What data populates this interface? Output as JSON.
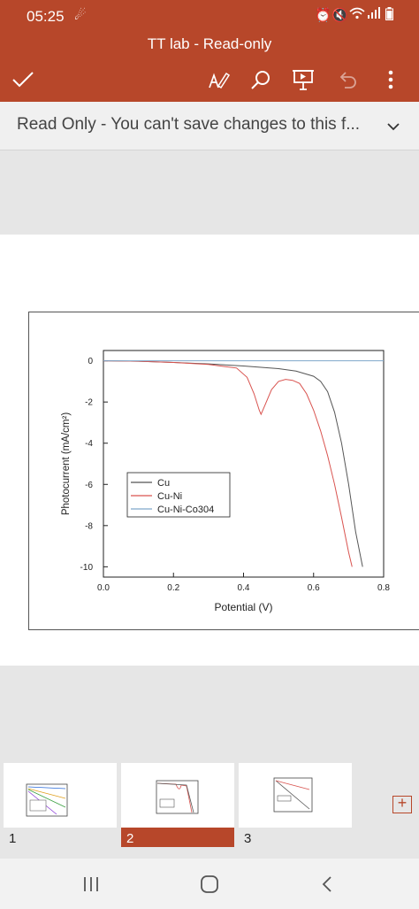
{
  "status_bar": {
    "time": "05:25"
  },
  "app_bar": {
    "title": "TT lab - Read-only"
  },
  "banner": {
    "text": "Read Only - You can't save changes to this f..."
  },
  "slide": {
    "chart_data": {
      "type": "line",
      "xlabel": "Potential (V)",
      "ylabel": "Photocurrent (mA/cm²)",
      "xlim": [
        0.0,
        0.8
      ],
      "ylim": [
        -10.5,
        0.5
      ],
      "x_ticks": [
        "0.0",
        "0.2",
        "0.4",
        "0.6",
        "0.8"
      ],
      "y_ticks": [
        "0",
        "-2",
        "-4",
        "-6",
        "-8",
        "-10"
      ],
      "legend_position": "lower-left",
      "series": [
        {
          "name": "Cu",
          "color": "#555555",
          "x": [
            0.0,
            0.1,
            0.2,
            0.3,
            0.4,
            0.5,
            0.55,
            0.6,
            0.62,
            0.64,
            0.66,
            0.68,
            0.7,
            0.72,
            0.74
          ],
          "y": [
            0.0,
            -0.02,
            -0.08,
            -0.15,
            -0.25,
            -0.38,
            -0.5,
            -0.75,
            -1.0,
            -1.5,
            -2.5,
            -4.0,
            -6.0,
            -8.3,
            -10.0
          ]
        },
        {
          "name": "Cu-Ni",
          "color": "#d9534f",
          "x": [
            0.0,
            0.1,
            0.2,
            0.3,
            0.38,
            0.41,
            0.43,
            0.445,
            0.45,
            0.46,
            0.48,
            0.5,
            0.52,
            0.54,
            0.56,
            0.58,
            0.6,
            0.62,
            0.64,
            0.66,
            0.68,
            0.7,
            0.71
          ],
          "y": [
            0.0,
            -0.02,
            -0.08,
            -0.18,
            -0.35,
            -0.8,
            -1.6,
            -2.4,
            -2.6,
            -2.2,
            -1.4,
            -1.0,
            -0.9,
            -0.95,
            -1.1,
            -1.6,
            -2.4,
            -3.4,
            -4.6,
            -6.0,
            -7.6,
            -9.3,
            -10.0
          ]
        },
        {
          "name": "Cu-Ni-Co304",
          "color": "#7fa7c9",
          "x": [
            0.0,
            0.8
          ],
          "y": [
            0.0,
            0.0
          ]
        }
      ]
    }
  },
  "thumbnails": [
    {
      "number": "1"
    },
    {
      "number": "2"
    },
    {
      "number": "3"
    }
  ],
  "add_slide": {
    "label": "+"
  }
}
